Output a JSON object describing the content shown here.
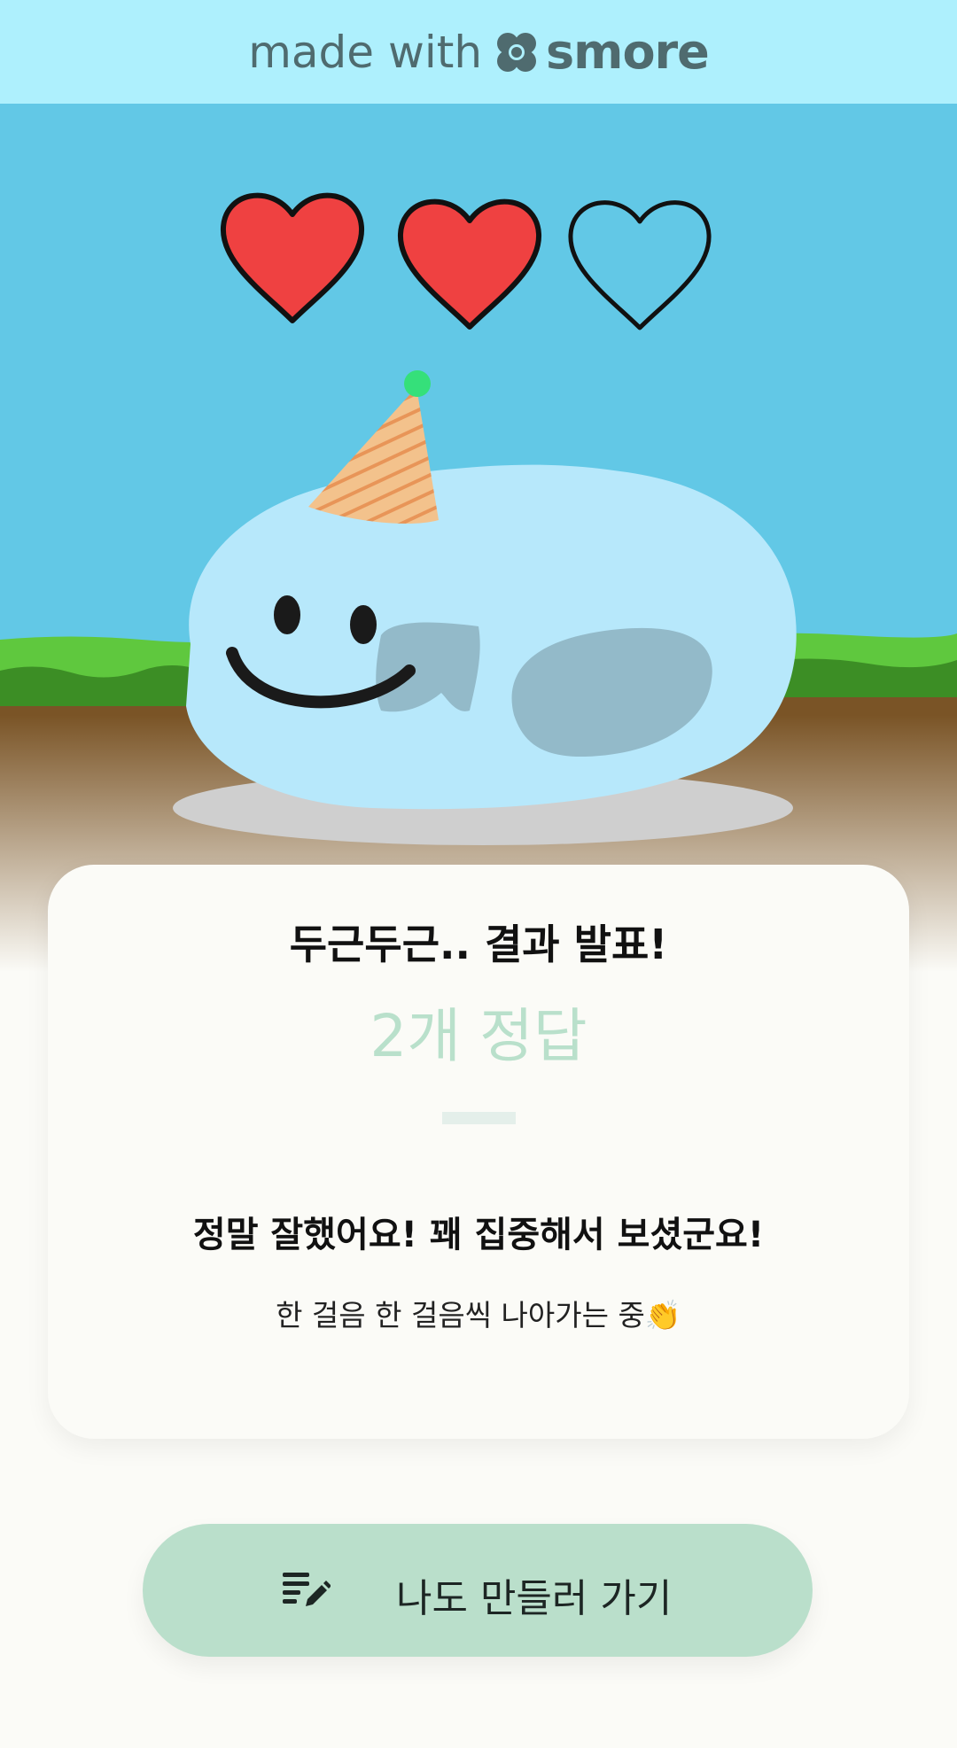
{
  "banner": {
    "made_with": "made with",
    "brand": "smore"
  },
  "scene": {
    "hearts_filled": 2,
    "hearts_total": 3,
    "colors": {
      "sky": "#62c8e6",
      "heart": "#ef4141",
      "slime": "#b7e8fb",
      "grass": "#5fc83e",
      "dirt": "#7a5426"
    },
    "icons": [
      "heart-icon",
      "slime-mascot",
      "party-hat"
    ]
  },
  "result_card": {
    "title": "두근두근.. 결과 발표!",
    "score": "2개 정답",
    "message": "정말 잘했어요! 꽤 집중해서 보셨군요!",
    "sub_message": "한 걸음 한 걸음씩 나아가는 중👏"
  },
  "cta": {
    "label": "나도 만들러 가기",
    "icon": "edit-list-icon"
  }
}
